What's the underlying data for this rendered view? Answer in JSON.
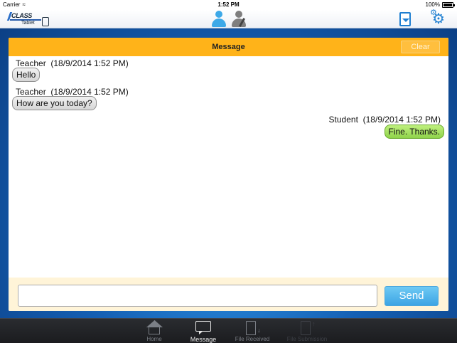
{
  "status_bar": {
    "carrier": "Carrier",
    "time": "1:52 PM",
    "battery": "100%"
  },
  "app": {
    "logo_top": "CLASS",
    "logo_sub": "Tablet"
  },
  "panel": {
    "title": "Message",
    "clear_label": "Clear"
  },
  "messages": [
    {
      "sender": "Teacher",
      "timestamp": "(18/9/2014 1:52 PM)",
      "text": "Hello",
      "side": "left"
    },
    {
      "sender": "Teacher",
      "timestamp": "(18/9/2014 1:52 PM)",
      "text": "How are you today?",
      "side": "left"
    },
    {
      "sender": "Student",
      "timestamp": "(18/9/2014 1:52 PM)",
      "text": "Fine. Thanks.",
      "side": "right"
    }
  ],
  "composer": {
    "value": "",
    "send_label": "Send"
  },
  "tabs": [
    {
      "label": "Home",
      "icon": "home-icon"
    },
    {
      "label": "Message",
      "icon": "message-icon",
      "active": true
    },
    {
      "label": "File Received",
      "icon": "file-received-icon"
    },
    {
      "label": "File Submission",
      "icon": "file-submission-icon",
      "disabled": true
    }
  ],
  "colors": {
    "header_orange": "#ffb319",
    "student_bubble": "#8fd34a",
    "accent_blue": "#1f7fd1"
  }
}
